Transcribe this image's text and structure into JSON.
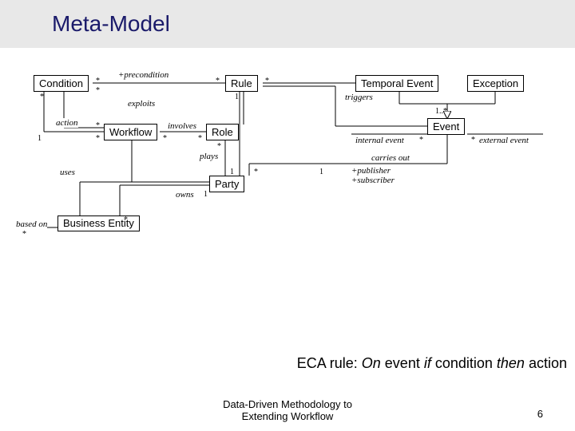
{
  "slide": {
    "title": "Meta-Model",
    "footer_line1": "Data-Driven Methodology to",
    "footer_line2": "Extending Workflow",
    "page_number": "6"
  },
  "diagram": {
    "entities": {
      "condition": "Condition",
      "rule": "Rule",
      "temporal_event": "Temporal Event",
      "exception": "Exception",
      "event": "Event",
      "workflow": "Workflow",
      "role": "Role",
      "party": "Party",
      "business_entity": "Business\nEntity"
    },
    "assoc_labels": {
      "precondition": "+precondition",
      "exploits": "exploits",
      "action": "action",
      "involves": "involves",
      "triggers": "triggers",
      "internal_event": "internal event",
      "external_event": "external event",
      "plays": "plays",
      "uses": "uses",
      "based_on": "based on",
      "carries_out": "carries out",
      "owns": "owns",
      "publisher": "+publisher",
      "subscriber": "+subscriber"
    },
    "mult": {
      "one": "1",
      "star": "*",
      "one_star": "1..*"
    }
  },
  "eca": {
    "prefix": "ECA rule: ",
    "on": "On",
    "event": " event ",
    "if": "if",
    "condition": " condition ",
    "then": "then",
    "action": " action"
  }
}
